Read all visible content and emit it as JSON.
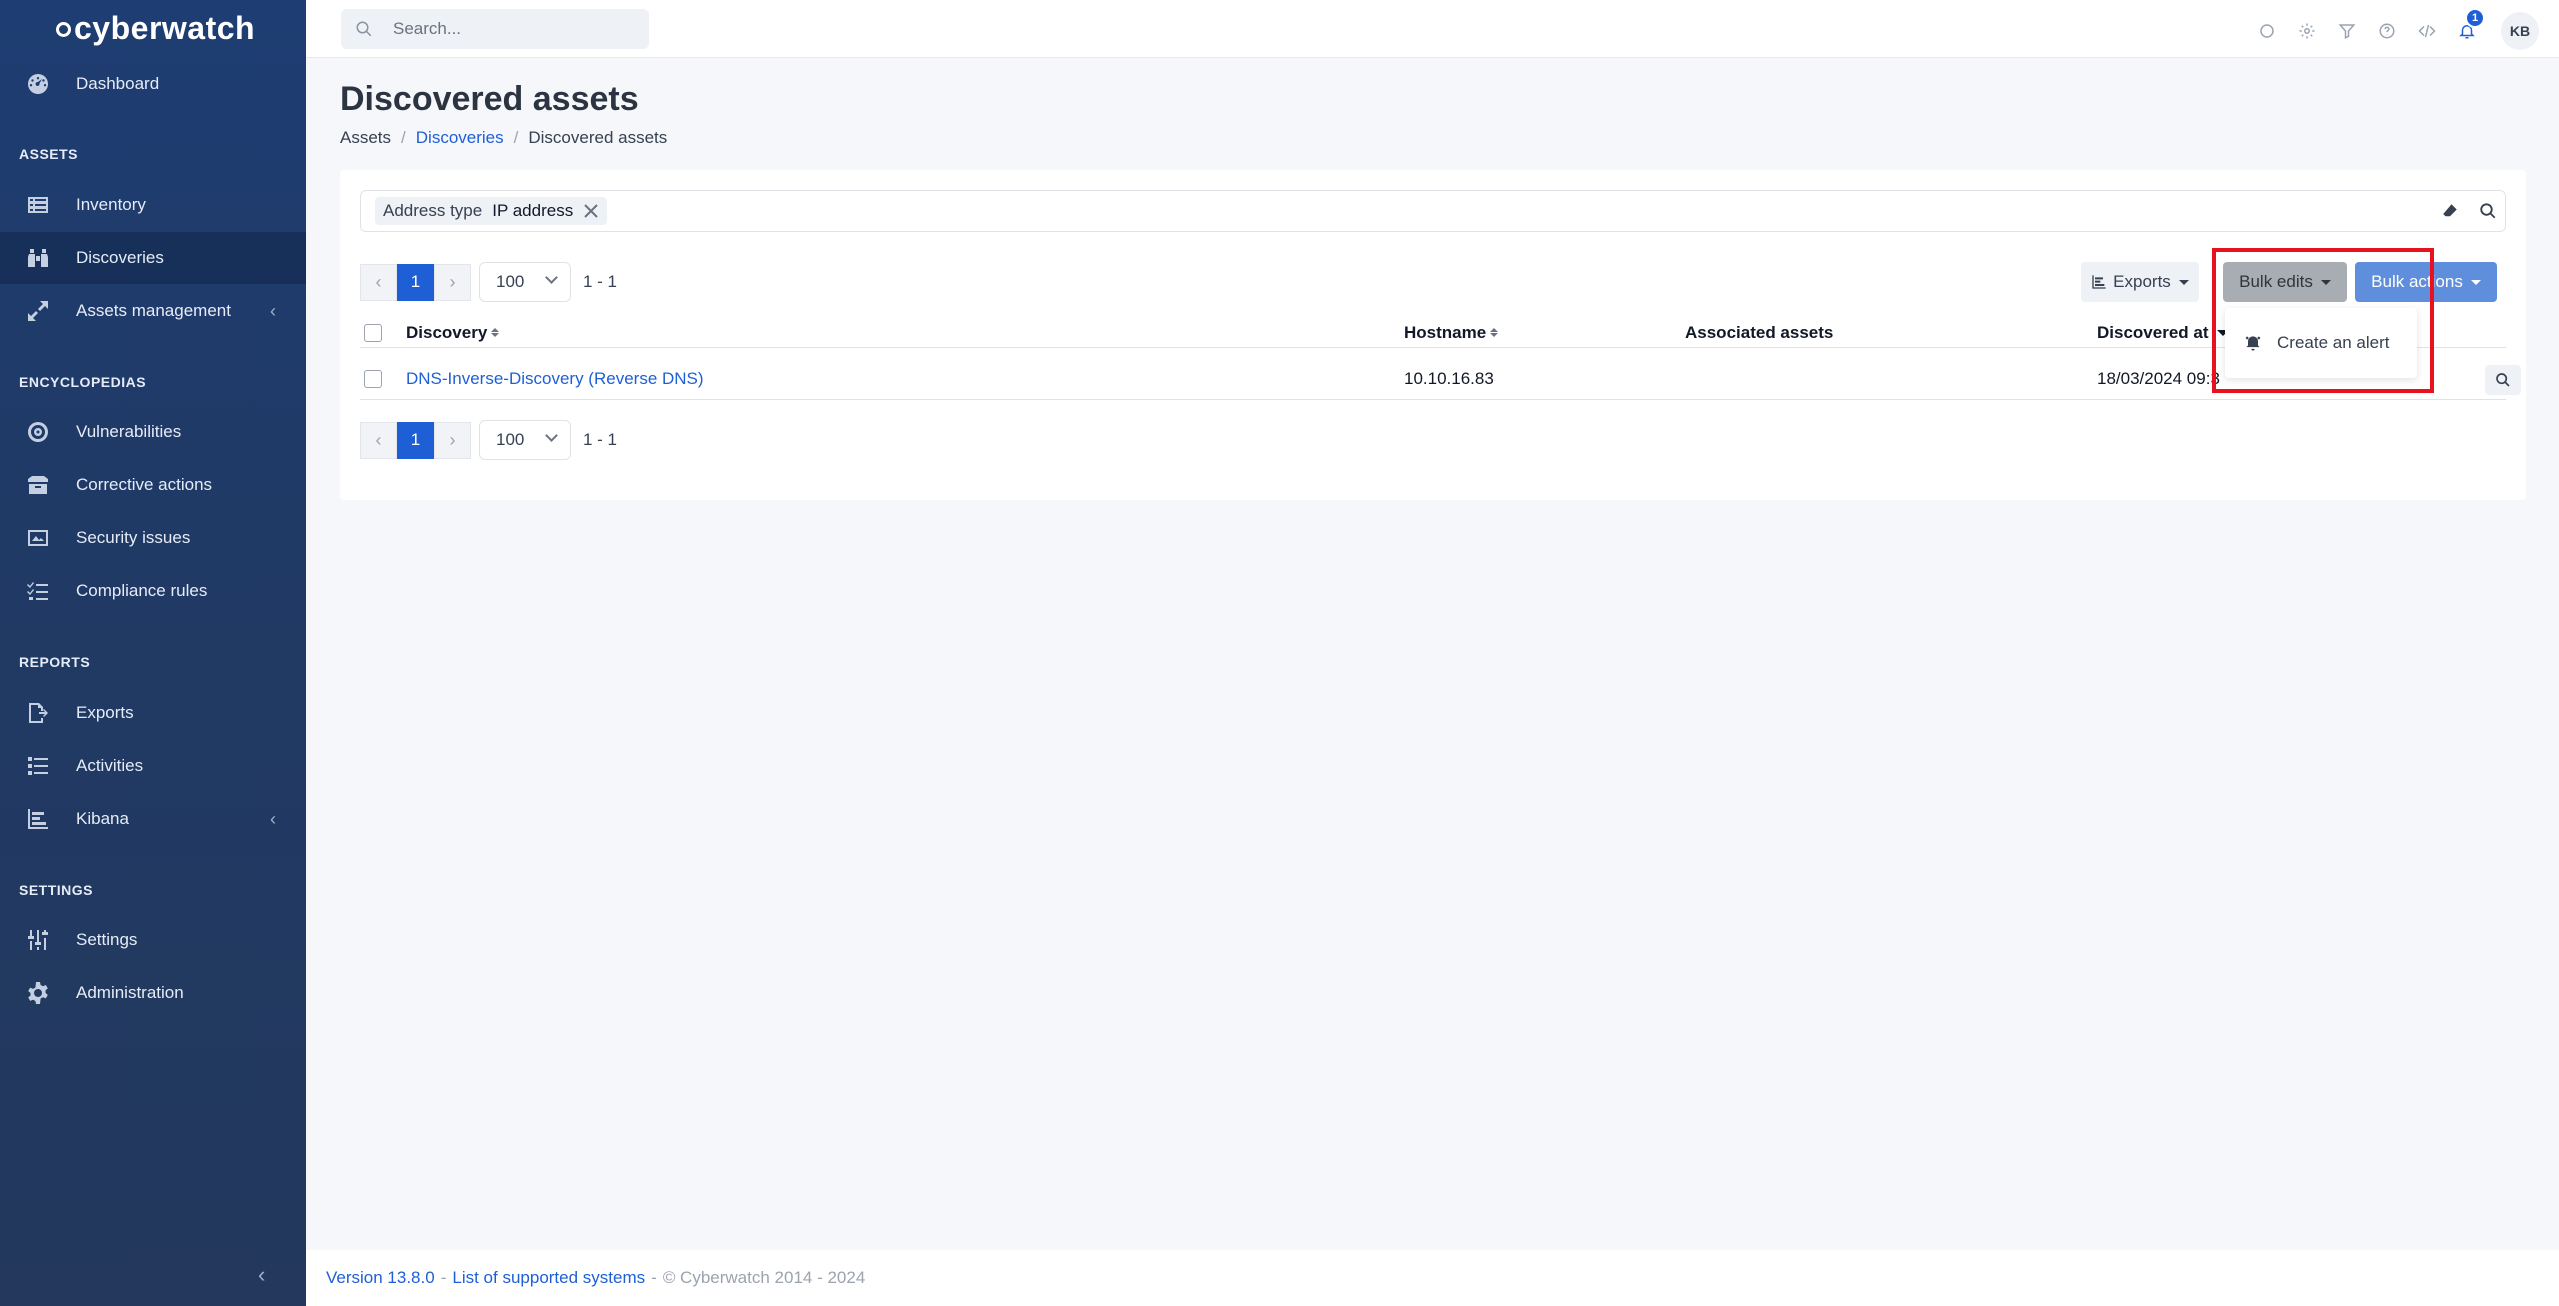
{
  "app": {
    "brand": "cyberwatch"
  },
  "search": {
    "placeholder": "Search..."
  },
  "sidebar": {
    "dashboard": "Dashboard",
    "sections": {
      "assets": "ASSETS",
      "encyclopedias": "ENCYCLOPEDIAS",
      "reports": "REPORTS",
      "settings": "SETTINGS"
    },
    "items": {
      "inventory": "Inventory",
      "discoveries": "Discoveries",
      "assets_management": "Assets management",
      "vulnerabilities": "Vulnerabilities",
      "corrective_actions": "Corrective actions",
      "security_issues": "Security issues",
      "compliance_rules": "Compliance rules",
      "exports": "Exports",
      "activities": "Activities",
      "kibana": "Kibana",
      "settings": "Settings",
      "administration": "Administration"
    }
  },
  "topbar": {
    "notifications_count": "1",
    "avatar_initials": "KB"
  },
  "page": {
    "title": "Discovered assets",
    "breadcrumb": {
      "root": "Assets",
      "sep": "/",
      "parent": "Discoveries",
      "current": "Discovered assets"
    }
  },
  "filter": {
    "key": "Address type",
    "value": "IP address"
  },
  "pagination": {
    "prev": "‹",
    "current_page": "1",
    "next": "›",
    "per_page": "100",
    "range": "1 - 1"
  },
  "toolbar": {
    "exports": "Exports",
    "bulk_edits": "Bulk edits",
    "bulk_actions": "Bulk actions"
  },
  "dropdown": {
    "create_alert": "Create an alert"
  },
  "table": {
    "headers": {
      "discovery": "Discovery",
      "hostname": "Hostname",
      "associated_assets": "Associated assets",
      "discovered_at": "Discovered at"
    },
    "rows": [
      {
        "discovery": "DNS-Inverse-Discovery (Reverse DNS)",
        "hostname": "10.10.16.83",
        "associated_assets": "",
        "discovered_at": "18/03/2024 09:3"
      }
    ]
  },
  "footer": {
    "version": "Version 13.8.0",
    "sep": "-",
    "systems": "List of supported systems",
    "copyright": "© Cyberwatch 2014 - 2024"
  }
}
